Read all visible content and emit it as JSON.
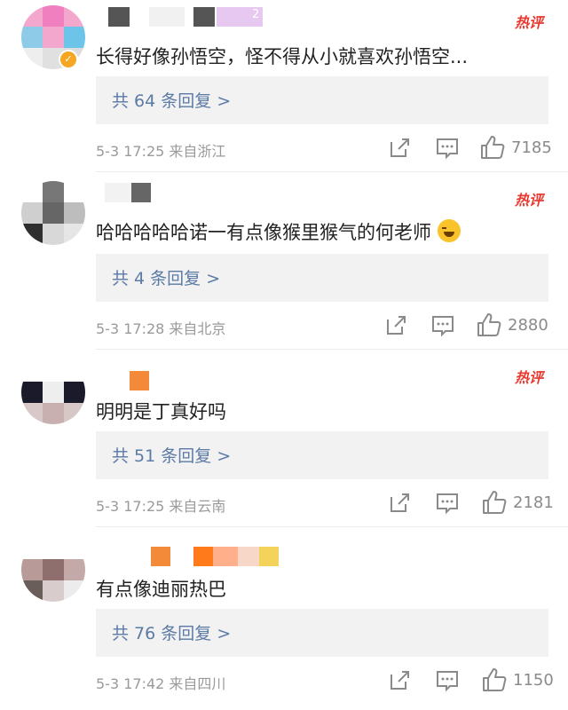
{
  "hot_badge": "热评",
  "comments": [
    {
      "text": "长得好像孙悟空，怪不得从小就喜欢孙悟空...",
      "replies_label": "共 64 条回复 >",
      "time_location": "5-3 17:25 来自浙江",
      "likes": "7185",
      "verified": true,
      "name_tag": "2"
    },
    {
      "text": "哈哈哈哈哈诺一有点像猴里猴气的何老师",
      "emoji": "laughing-crying-emoji",
      "replies_label": "共 4 条回复 >",
      "time_location": "5-3 17:28 来自北京",
      "likes": "2880"
    },
    {
      "text": "明明是丁真好吗",
      "replies_label": "共 51 条回复 >",
      "time_location": "5-3 17:25 来自云南",
      "likes": "2181"
    },
    {
      "text": "有点像迪丽热巴",
      "replies_label": "共 76 条回复 >",
      "time_location": "5-3 17:42 来自四川",
      "likes": "1150"
    }
  ],
  "icons": {
    "share": "share-icon",
    "comment": "comment-icon",
    "like": "thumbs-up-icon"
  },
  "colors": {
    "hot": "#e8392f",
    "reply_link": "#5b7aa6",
    "meta": "#9a9a9a"
  }
}
